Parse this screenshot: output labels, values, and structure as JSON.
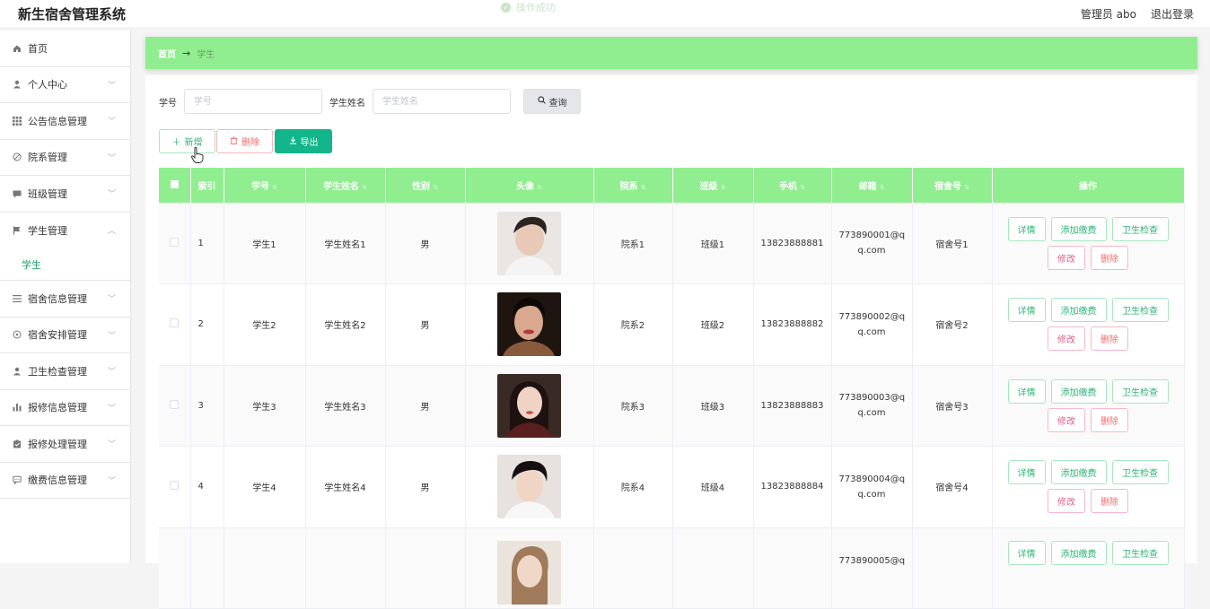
{
  "app": {
    "title": "新生宿舍管理系统",
    "admin_label": "管理员 abo",
    "logout_label": "退出登录",
    "toast": "操作成功"
  },
  "sidebar": {
    "items": [
      {
        "label": "首页",
        "icon": "home-icon"
      },
      {
        "label": "个人中心",
        "icon": "user-icon"
      },
      {
        "label": "公告信息管理",
        "icon": "grid-icon"
      },
      {
        "label": "院系管理",
        "icon": "compass-icon"
      },
      {
        "label": "班级管理",
        "icon": "chat-icon"
      },
      {
        "label": "学生管理",
        "icon": "flag-icon",
        "expanded": true
      },
      {
        "label": "宿舍信息管理",
        "icon": "list-icon"
      },
      {
        "label": "宿舍安排管理",
        "icon": "globe-icon"
      },
      {
        "label": "卫生检查管理",
        "icon": "user-icon"
      },
      {
        "label": "报修信息管理",
        "icon": "bar-chart-icon"
      },
      {
        "label": "报修处理管理",
        "icon": "clipboard-icon"
      },
      {
        "label": "缴费信息管理",
        "icon": "message-icon"
      }
    ],
    "submenu": "学生"
  },
  "breadcrumb": {
    "home": "首页",
    "separator": "→",
    "current": "学生"
  },
  "search": {
    "id_label": "学号",
    "id_placeholder": "学号",
    "name_label": "学生姓名",
    "name_placeholder": "学生姓名",
    "query_button": "查询"
  },
  "actions": {
    "add": "新增",
    "delete": "删除",
    "export": "导出"
  },
  "table": {
    "headers": [
      "索引",
      "学号",
      "学生姓名",
      "性别",
      "头像",
      "院系",
      "班级",
      "手机",
      "邮箱",
      "宿舍号",
      "操作"
    ],
    "op_labels": {
      "detail": "详情",
      "pay": "添加缴费",
      "check": "卫生检查",
      "edit": "修改",
      "remove": "删除"
    },
    "rows": [
      {
        "index": "1",
        "sid": "学生1",
        "name": "学生姓名1",
        "gender": "男",
        "dept": "院系1",
        "class": "班级1",
        "phone": "13823888881",
        "email1": "773890001@q",
        "email2": "q.com",
        "dorm": "宿舍号1"
      },
      {
        "index": "2",
        "sid": "学生2",
        "name": "学生姓名2",
        "gender": "男",
        "dept": "院系2",
        "class": "班级2",
        "phone": "13823888882",
        "email1": "773890002@q",
        "email2": "q.com",
        "dorm": "宿舍号2"
      },
      {
        "index": "3",
        "sid": "学生3",
        "name": "学生姓名3",
        "gender": "男",
        "dept": "院系3",
        "class": "班级3",
        "phone": "13823888883",
        "email1": "773890003@q",
        "email2": "q.com",
        "dorm": "宿舍号3"
      },
      {
        "index": "4",
        "sid": "学生4",
        "name": "学生姓名4",
        "gender": "男",
        "dept": "院系4",
        "class": "班级4",
        "phone": "13823888884",
        "email1": "773890004@q",
        "email2": "q.com",
        "dorm": "宿舍号4"
      },
      {
        "index": "",
        "sid": "",
        "name": "",
        "gender": "",
        "dept": "",
        "class": "",
        "phone": "",
        "email1": "773890005@q",
        "email2": "",
        "dorm": ""
      }
    ]
  },
  "colors": {
    "accent": "#90ee90",
    "primary": "#13b58a",
    "danger": "#f56c6c"
  }
}
